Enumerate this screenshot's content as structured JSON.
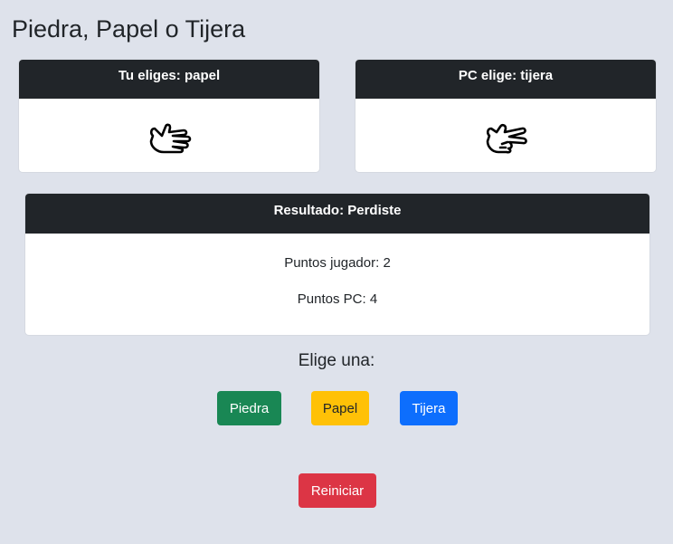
{
  "title": "Piedra, Papel o Tijera",
  "player_card": {
    "header": "Tu eliges: papel",
    "icon": "paper-hand-icon"
  },
  "pc_card": {
    "header": "PC elige: tijera",
    "icon": "scissors-hand-icon"
  },
  "result_card": {
    "header": "Resultado: Perdiste",
    "player_points": "Puntos jugador: 2",
    "pc_points": "Puntos PC: 4"
  },
  "choose_label": "Elige una:",
  "buttons": {
    "piedra": "Piedra",
    "papel": "Papel",
    "tijera": "Tijera",
    "reiniciar": "Reiniciar"
  },
  "colors": {
    "background": "#dee2eb",
    "header": "#212529",
    "success": "#198754",
    "warning": "#ffc107",
    "primary": "#0d6efd",
    "danger": "#dc3545"
  }
}
